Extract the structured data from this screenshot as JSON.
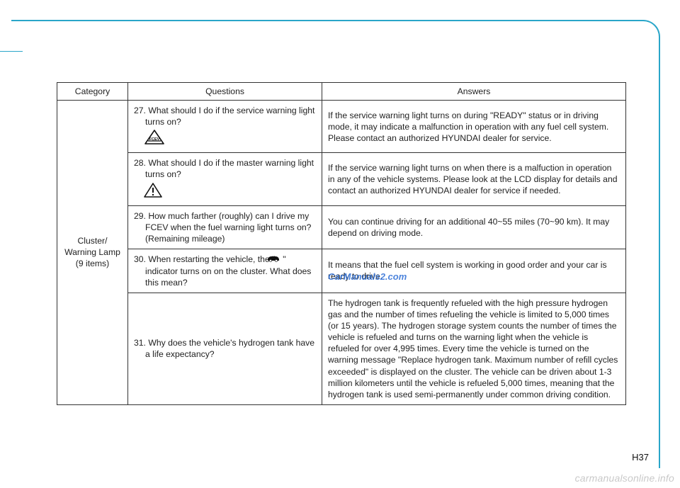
{
  "headers": {
    "category": "Category",
    "questions": "Questions",
    "answers": "Answers"
  },
  "category_label": [
    "Cluster/",
    "Warning Lamp",
    "(9 items)"
  ],
  "rows": [
    {
      "q": "27. What should I do if the service warning light turns on?",
      "a": "If the service warning light turns on during \"READY\" status or in driving mode, it may indicate a malfunction in operation with any fuel cell system. Please contact an authorized HYUNDAI dealer for service."
    },
    {
      "q": "28. What should I do if the master warning light turns on?",
      "a": "If the service warning light turns on when there is a malfuction in operation in any of the vehicle systems. Please look at the LCD display for details and contact an authorized HYUNDAI dealer for service if needed."
    },
    {
      "q": "29. How much farther (roughly) can I drive my FCEV when the fuel warning light turns on? (Remaining mileage)",
      "a": "You can continue driving for an additional 40~55 miles (70~90 km). It may depend on driving mode."
    },
    {
      "q_pre": "30. When restarting the vehicle, the \" ",
      "q_post": " \" indicator turns on on the cluster. What does this mean?",
      "a": "It means that the fuel cell system is working in good order and your car is ready to drive."
    },
    {
      "q": "31. Why does the vehicle's hydrogen tank have a life expectancy?",
      "a": "The hydrogen tank is frequently refueled with the high pressure hydrogen gas and the number of times refueling the vehicle is limited to 5,000 times (or 15 years). The hydrogen storage system counts the number of times the vehicle is refueled and turns on the warning light when the vehicle is refueled for over 4,995 times. Every time the vehicle is turned on the warning message \"Replace hydrogen tank. Maximum number of refill cycles exceeded\" is displayed on the cluster. The vehicle can be driven about 1-3 million kilometers until the vehicle is refueled 5,000 times, meaning that the hydrogen tank is used semi-permanently under common driving condition."
    }
  ],
  "watermark_center": "CarManuals2.com",
  "page_number": "H37",
  "footer_watermark": "carmanualsonline.info"
}
